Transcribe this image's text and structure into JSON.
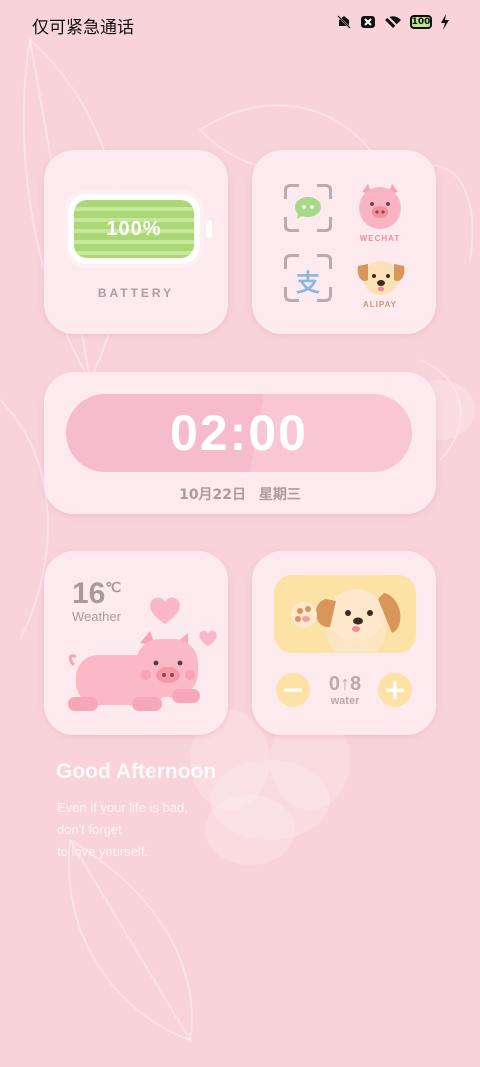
{
  "status_bar": {
    "carrier_text": "仅可紧急通话",
    "icons": [
      "vibrate-off-icon",
      "nfc-icon",
      "wifi-icon",
      "battery-icon",
      "charging-icon"
    ],
    "battery_level": "100"
  },
  "battery_widget": {
    "percent_text": "100%",
    "label": "BATTERY",
    "level": 1.0
  },
  "apps_widget": {
    "apps": [
      {
        "icon": "wechat-icon",
        "label": "WECHAT"
      },
      {
        "icon": "alipay-icon",
        "label": "ALIPAY"
      }
    ],
    "alipay_glyph": "支"
  },
  "clock_widget": {
    "time": "02:00",
    "date": "10月22日 星期三"
  },
  "weather_widget": {
    "temperature": "16",
    "unit": "℃",
    "label": "Weather"
  },
  "water_widget": {
    "count": "0↑8",
    "label": "water",
    "minus": "−",
    "plus": "+"
  },
  "greeting": {
    "title": "Good Afternoon",
    "lines": [
      "Even if your life is bad,",
      "don't forget",
      "to love yourself."
    ]
  },
  "colors": {
    "background": "#f8d3da",
    "battery_green": "#a9d874",
    "clock_pill": "#f7bccb",
    "water_yellow": "#fde2a6"
  }
}
